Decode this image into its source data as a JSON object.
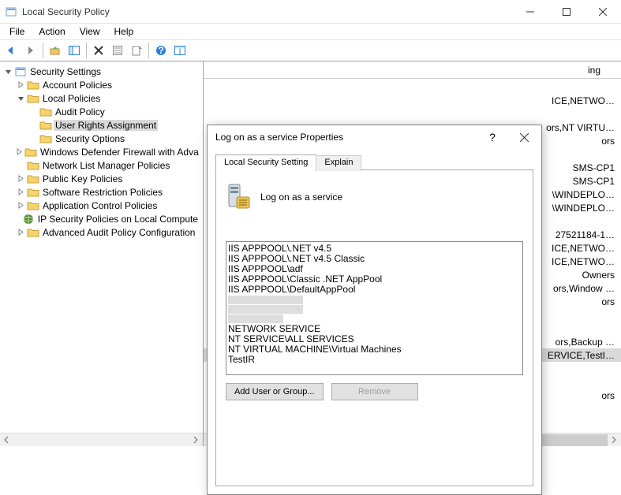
{
  "window": {
    "title": "Local Security Policy",
    "menus": [
      "File",
      "Action",
      "View",
      "Help"
    ]
  },
  "tree": {
    "root": "Security Settings",
    "nodes": [
      {
        "label": "Account Policies",
        "expandable": true,
        "expanded": false
      },
      {
        "label": "Local Policies",
        "expandable": true,
        "expanded": true,
        "children": [
          {
            "label": "Audit Policy"
          },
          {
            "label": "User Rights Assignment",
            "selected": true
          },
          {
            "label": "Security Options"
          }
        ]
      },
      {
        "label": "Windows Defender Firewall with Adva",
        "expandable": true,
        "expanded": false
      },
      {
        "label": "Network List Manager Policies"
      },
      {
        "label": "Public Key Policies",
        "expandable": true,
        "expanded": false
      },
      {
        "label": "Software Restriction Policies",
        "expandable": true,
        "expanded": false
      },
      {
        "label": "Application Control Policies",
        "expandable": true,
        "expanded": false
      },
      {
        "label": "IP Security Policies on Local Compute",
        "ipicon": true
      },
      {
        "label": "Advanced Audit Policy Configuration",
        "expandable": true,
        "expanded": false
      }
    ]
  },
  "listcol": "ing",
  "listrows": [
    "",
    "ICE,NETWO…",
    "",
    "ors,NT VIRTU…",
    "ors",
    "",
    "SMS-CP1",
    "SMS-CP1",
    "\\WINDEPLO…",
    "\\WINDEPLO…",
    "",
    "27521184-1…",
    "ICE,NETWO…",
    "ICE,NETWO…",
    " Owners",
    "ors,Window …",
    "ors",
    "",
    "",
    "ors,Backup …",
    "ERVICE,TestI…",
    "",
    "",
    "ors"
  ],
  "selectedRow": 20,
  "dialog": {
    "title": "Log on as a service Properties",
    "tabs": [
      "Local Security Setting",
      "Explain"
    ],
    "policyName": "Log on as a service",
    "principals": [
      "IIS APPPOOL\\.NET v4.5",
      "IIS APPPOOL\\.NET v4.5 Classic",
      "IIS APPPOOL\\adf",
      "IIS APPPOOL\\Classic .NET AppPool",
      "IIS APPPOOL\\DefaultAppPool"
    ],
    "principals2": [
      "NETWORK SERVICE",
      "NT SERVICE\\ALL SERVICES",
      "NT VIRTUAL MACHINE\\Virtual Machines",
      "TestIR"
    ],
    "addBtn": "Add User or Group...",
    "removeBtn": "Remove"
  }
}
